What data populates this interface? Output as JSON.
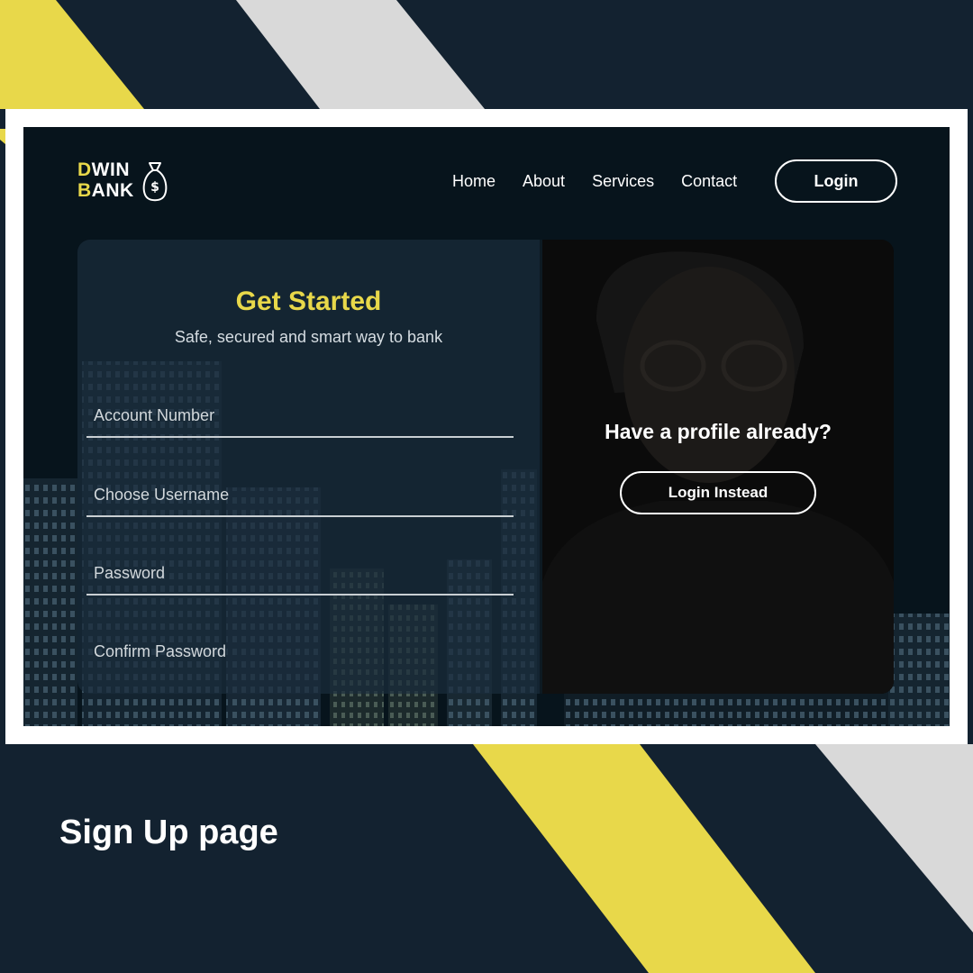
{
  "brand": {
    "line1_first": "D",
    "line1_rest": "WIN",
    "line2_first": "B",
    "line2_rest": "ANK",
    "icon": "money-bag-icon"
  },
  "nav": {
    "items": [
      "Home",
      "About",
      "Services",
      "Contact"
    ],
    "login_label": "Login"
  },
  "signup": {
    "title": "Get Started",
    "subtitle": "Safe, secured and smart way to bank",
    "fields": [
      {
        "placeholder": "Account Number"
      },
      {
        "placeholder": "Choose Username"
      },
      {
        "placeholder": "Password"
      },
      {
        "placeholder": "Confirm Password"
      }
    ]
  },
  "profile": {
    "title": "Have a profile already?",
    "button_label": "Login Instead"
  },
  "caption": "Sign Up page",
  "colors": {
    "accent_yellow": "#e8d84a",
    "background_navy": "#132230",
    "stripe_gray": "#d9d9d9",
    "screen_dark": "#07141c"
  }
}
